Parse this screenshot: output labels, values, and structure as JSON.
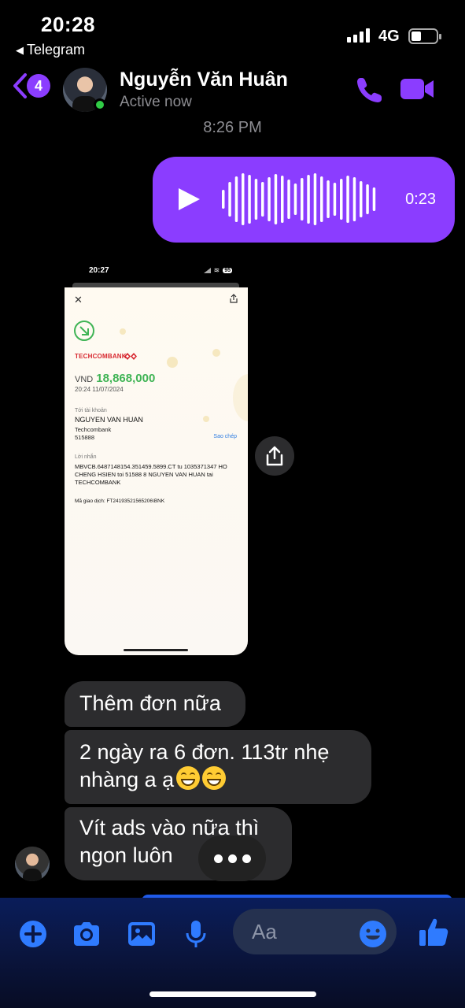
{
  "status_bar": {
    "time": "20:28",
    "back_app": "Telegram",
    "network": "4G"
  },
  "header": {
    "unread_count": "4",
    "contact_name": "Nguyễn Văn Huân",
    "contact_status": "Active now"
  },
  "conversation": {
    "timestamp": "8:26 PM",
    "voice_message": {
      "duration": "0:23"
    },
    "screenshot": {
      "status_time": "20:27",
      "battery": "95",
      "bank_name": "TECHCOMBANK",
      "currency": "VND",
      "amount": "18,868,000",
      "datetime": "20:24 11/07/2024",
      "to_account_label": "Tới tài khoản",
      "recipient_name": "NGUYEN VAN HUAN",
      "recipient_bank": "Techcombank",
      "account_number": "515888",
      "copy_label": "Sao chép",
      "message_label": "Lời nhắn",
      "message": "MBVCB.6487148154.351459.5899.CT tu 1035371347 HO CHENG HSIEN toi 51588 8 NGUYEN VAN HUAN tai TECHCOMBANK",
      "transaction_id": "Mã giao dịch: FT24193521565206\\BNK"
    },
    "messages": [
      {
        "text": "Thêm đơn nữa"
      },
      {
        "line1": "2 ngày ra 6 đơn. 113tr nhẹ",
        "line2": "nhàng a ạ"
      },
      {
        "line1": "Vít ads vào nữa thì",
        "line2": "ngon luôn"
      }
    ]
  },
  "composer": {
    "placeholder": "Aa"
  },
  "colors": {
    "accent": "#8b3dff",
    "bubble_incoming": "#2c2c2e",
    "online": "#31cc46",
    "composer_icons": "#2f7bff"
  },
  "icons": [
    "phone-icon",
    "video-camera-icon",
    "play-icon",
    "share-icon",
    "plus-icon",
    "camera-icon",
    "image-icon",
    "microphone-icon",
    "emoji-icon",
    "thumbs-up-icon"
  ]
}
